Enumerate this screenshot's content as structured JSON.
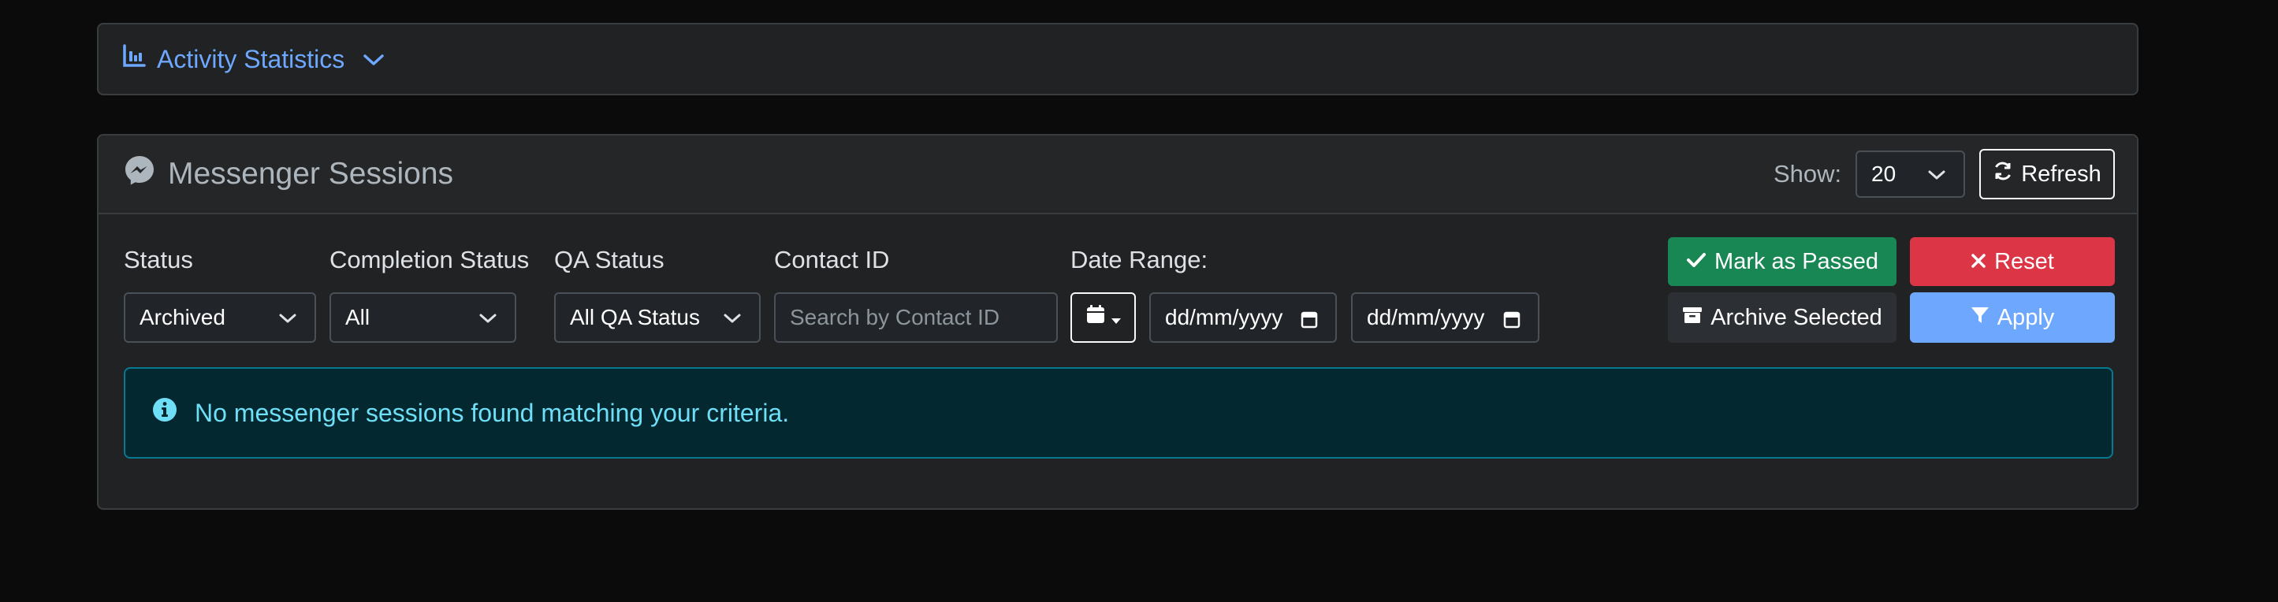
{
  "activity": {
    "title": "Activity Statistics"
  },
  "sessions": {
    "title": "Messenger Sessions",
    "show_label": "Show:",
    "page_size": "20",
    "refresh_label": "Refresh"
  },
  "filters": {
    "status_label": "Status",
    "status_value": "Archived",
    "completion_label": "Completion Status",
    "completion_value": "All",
    "qa_label": "QA Status",
    "qa_value": "All QA Status",
    "contact_label": "Contact ID",
    "contact_placeholder": "Search by Contact ID",
    "date_label": "Date Range:",
    "date_from_placeholder": "dd/mm/yyyy",
    "date_to_placeholder": "dd/mm/yyyy"
  },
  "actions": {
    "mark_passed": "Mark as Passed",
    "reset": "Reset",
    "archive_selected": "Archive Selected",
    "apply": "Apply"
  },
  "alert": {
    "message": "No messenger sessions found matching your criteria."
  },
  "colors": {
    "accent_blue": "#6ea8fe",
    "success": "#198754",
    "danger": "#dc3545",
    "primary_light": "#6ea8fe",
    "info_text": "#6edff6"
  }
}
